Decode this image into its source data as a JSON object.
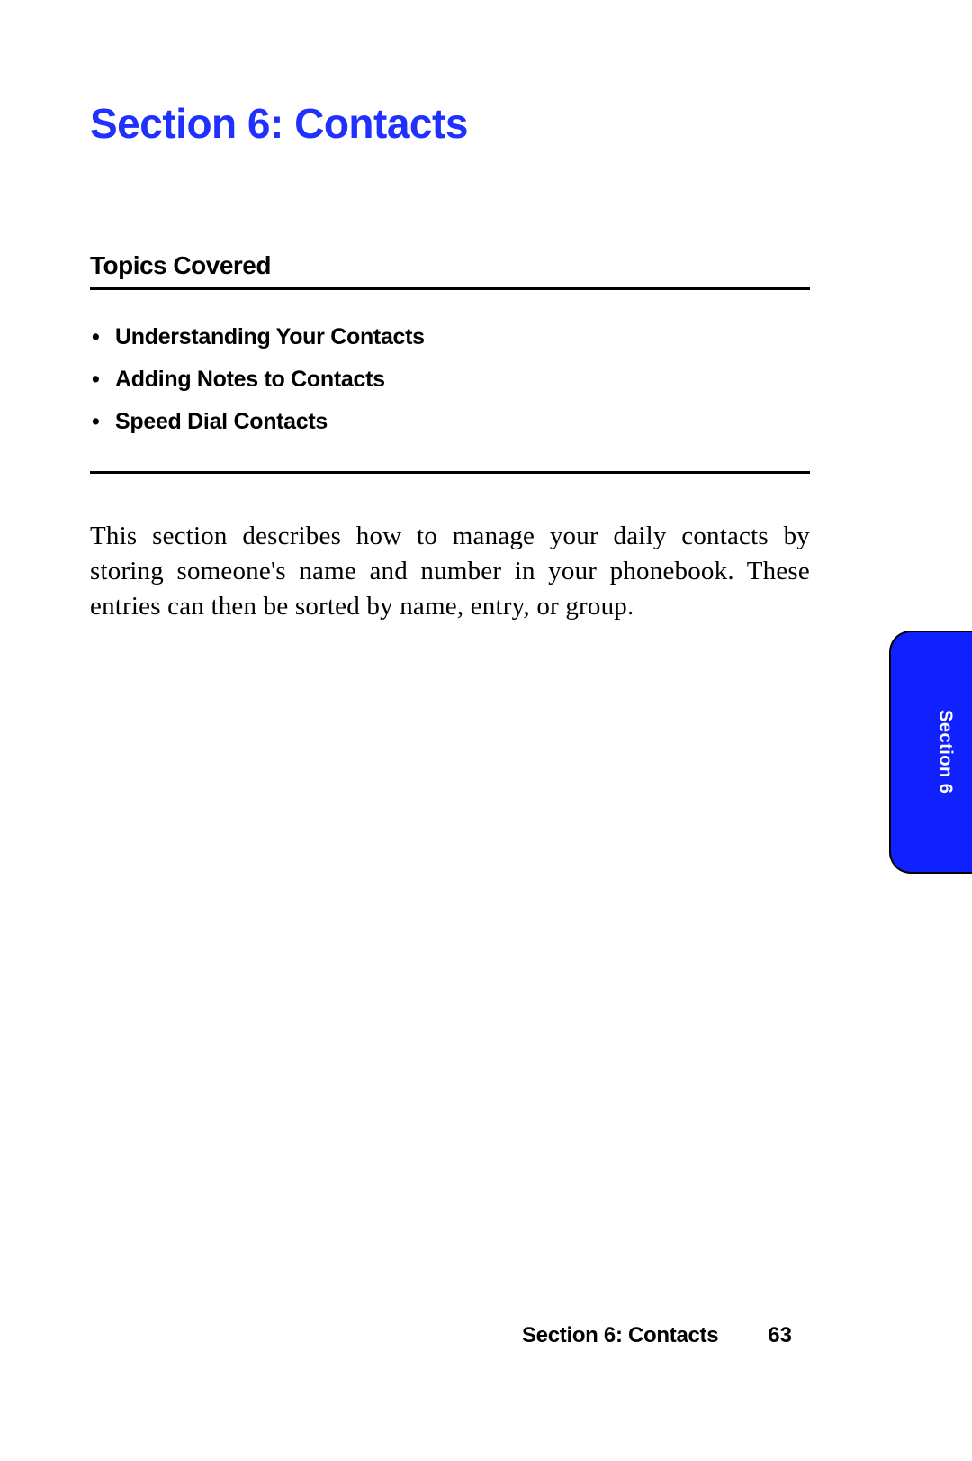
{
  "title": "Section 6: Contacts",
  "topics": {
    "heading": "Topics Covered",
    "items": [
      "Understanding Your Contacts",
      "Adding Notes to Contacts",
      "Speed Dial Contacts"
    ]
  },
  "body": "This section describes how to manage your daily contacts by storing someone's name and number in your phonebook. These entries can then be sorted by name, entry, or group.",
  "side_tab": "Section 6",
  "footer": {
    "section": "Section 6: Contacts",
    "page": "63"
  }
}
